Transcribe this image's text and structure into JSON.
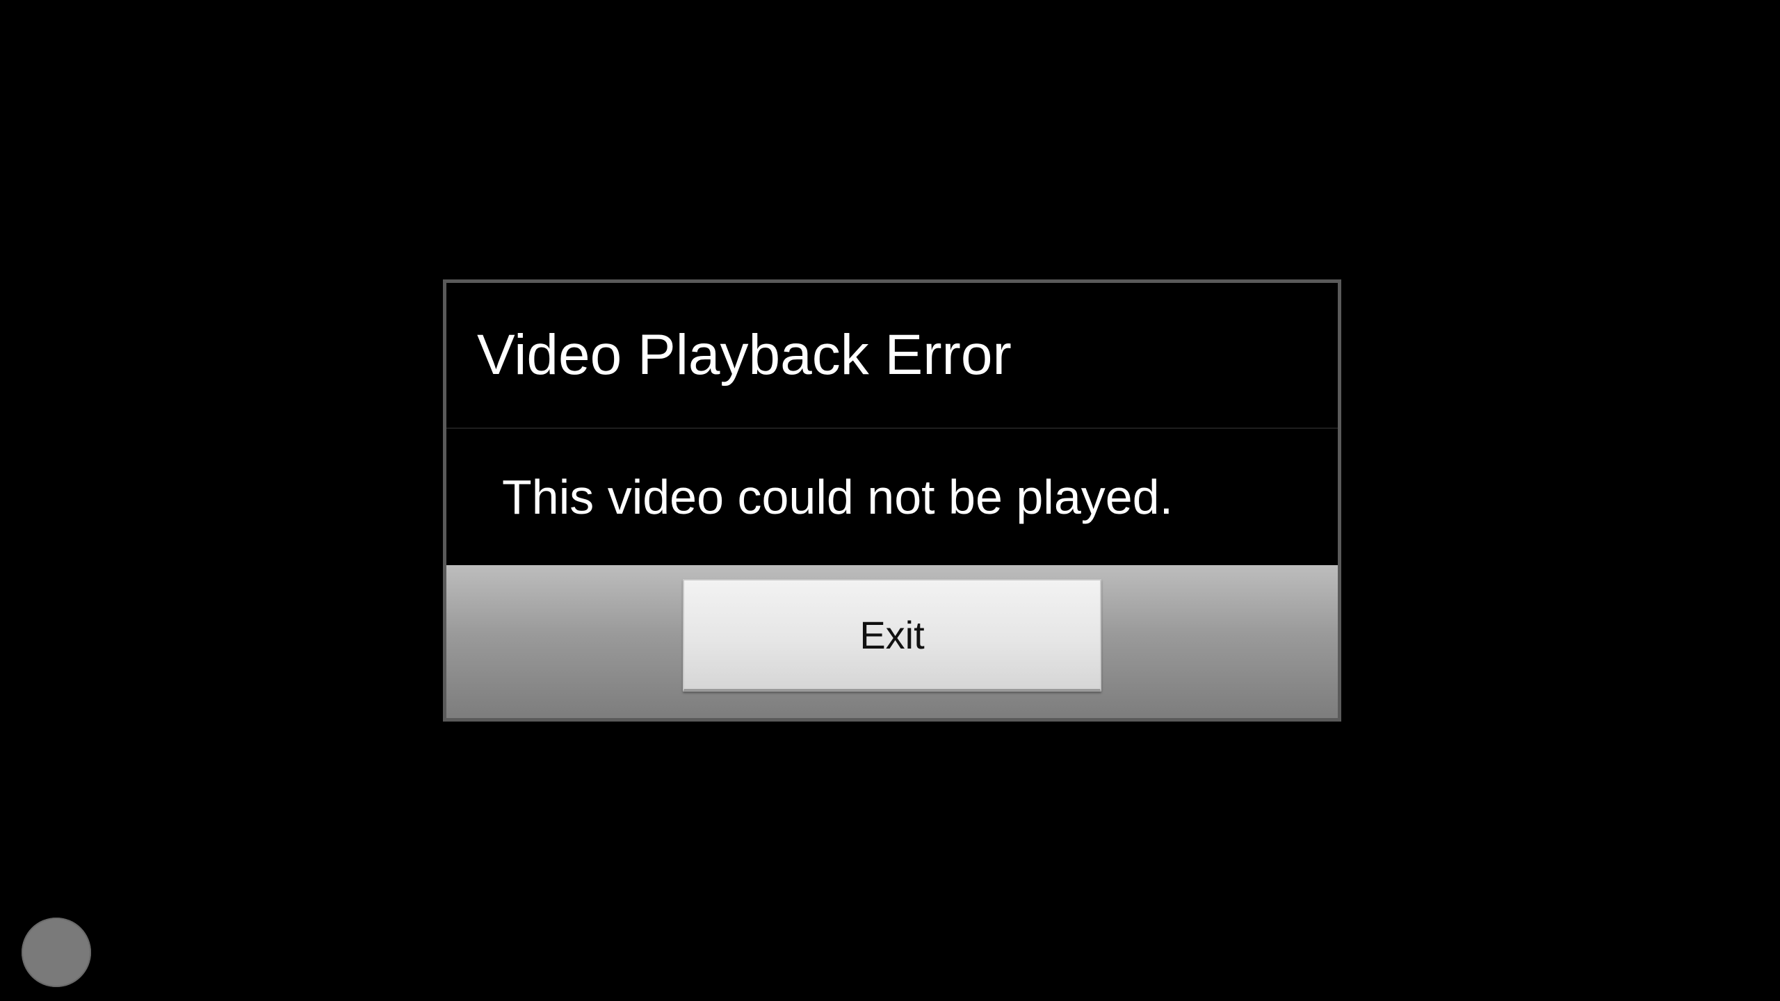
{
  "dialog": {
    "title": "Video Playback Error",
    "message": "This video could not be played.",
    "exit_label": "Exit"
  },
  "colors": {
    "background": "#000000",
    "dialog_border": "#5a5a5a",
    "text": "#ffffff",
    "footer_gradient_top": "#bdbdbd",
    "footer_gradient_bottom": "#7d7d7d",
    "button_face": "#e6e6e6",
    "assist_button": "#7a7a7a"
  },
  "floating": {
    "icon": "assistive-touch-icon"
  }
}
